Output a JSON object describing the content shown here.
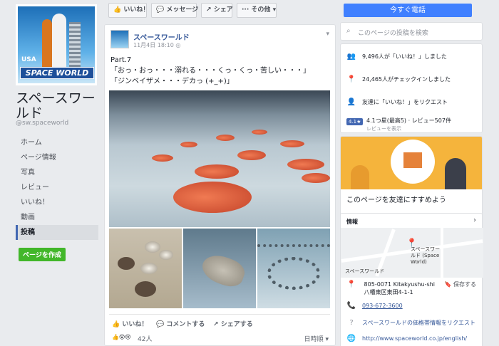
{
  "page": {
    "name": "スペースワールド",
    "handle": "@sw.spaceworld",
    "cover_text_usa": "USA",
    "cover_text_logo": "SPACE WORLD"
  },
  "nav": {
    "items": [
      {
        "label": "ホーム"
      },
      {
        "label": "ページ情報"
      },
      {
        "label": "写真"
      },
      {
        "label": "レビュー"
      },
      {
        "label": "いいね！"
      },
      {
        "label": "動画"
      },
      {
        "label": "投稿",
        "active": true
      }
    ],
    "create_label": "ページを作成"
  },
  "toolbar": {
    "like_label": "いいね！",
    "message_label": "メッセージ",
    "share_label": "シェア",
    "more_label": "その他",
    "call_label": "今すぐ電話"
  },
  "post": {
    "author": "スペースワールド",
    "date": "11月4日 18:10",
    "line1": "Part.7",
    "line2": "「おっ・おっ・・・溺れる・・・くっ・くっ・苦しい・・・」",
    "line3": "「ジンベイザメ・・・デカっ (+_+)」",
    "like_action": "いいね！",
    "comment_action": "コメントする",
    "share_action": "シェアする",
    "reaction_count": "42人",
    "sort_label": "日時順"
  },
  "sidebar": {
    "search_placeholder": "このページの投稿を検索",
    "likes": "9,496人が「いいね！」しました",
    "checkins": "24,465人がチェックインしました",
    "invite": "友達に「いいね！」をリクエスト",
    "rating_badge": "4.1★",
    "rating_text": "4.1つ星(最高5) · レビュー507件",
    "rating_link": "レビューを表示",
    "promo_text": "このページを友達にすすめよう",
    "info_title": "情報",
    "map_label_1": "スペースワー",
    "map_label_2": "ルド (Space",
    "map_label_3": "World)",
    "map_label_4": "スペースワールド",
    "address_1": "805-0071 Kitakyushu-shi",
    "address_2": "八幡東区東田4-1-1",
    "save_label": "保存する",
    "phone": "093-672-3600",
    "price_request": "スペースワールドの価格帯情報をリクエスト",
    "website": "http://www.spaceworld.co.jp/english/"
  }
}
